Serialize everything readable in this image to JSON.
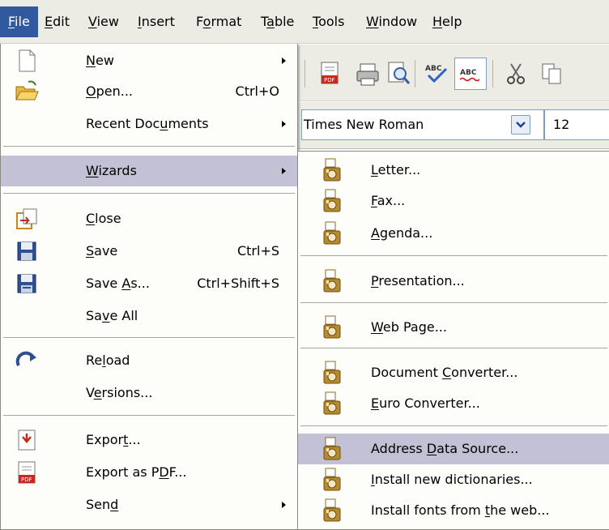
{
  "menubar": {
    "items": [
      {
        "label": "File",
        "mnemonic": "F",
        "rest": "ile"
      },
      {
        "label": "Edit",
        "mnemonic": "E",
        "rest": "dit"
      },
      {
        "label": "View",
        "mnemonic": "V",
        "rest": "iew"
      },
      {
        "label": "Insert",
        "mnemonic": "I",
        "rest": "nsert"
      },
      {
        "label": "Format",
        "pre": "F",
        "mnemonic": "o",
        "rest": "rmat"
      },
      {
        "label": "Table",
        "pre": "T",
        "mnemonic": "a",
        "rest": "ble"
      },
      {
        "label": "Tools",
        "mnemonic": "T",
        "rest": "ools"
      },
      {
        "label": "Window",
        "mnemonic": "W",
        "rest": "indow"
      },
      {
        "label": "Help",
        "mnemonic": "H",
        "rest": "elp"
      }
    ]
  },
  "toolbar": {
    "font_name": "Times New Roman",
    "font_size": "12",
    "icons": [
      "export-pdf-icon",
      "print-icon",
      "page-preview-icon",
      "spellcheck-icon",
      "autospellcheck-icon",
      "cut-icon",
      "copy-icon"
    ]
  },
  "file_menu": {
    "new": {
      "pre": "",
      "mn": "N",
      "post": "ew"
    },
    "open": {
      "pre": "",
      "mn": "O",
      "post": "pen...",
      "accel": "Ctrl+O"
    },
    "recent": {
      "pre": "Recent Doc",
      "mn": "u",
      "post": "ments"
    },
    "wizards": {
      "pre": "",
      "mn": "W",
      "post": "izards"
    },
    "close": {
      "pre": "",
      "mn": "C",
      "post": "lose"
    },
    "save": {
      "pre": "",
      "mn": "S",
      "post": "ave",
      "accel": "Ctrl+S"
    },
    "save_as": {
      "pre": "Save ",
      "mn": "A",
      "post": "s...",
      "accel": "Ctrl+Shift+S"
    },
    "save_all": {
      "pre": "Sa",
      "mn": "v",
      "post": "e All"
    },
    "reload": {
      "pre": "Re",
      "mn": "l",
      "post": "oad"
    },
    "versions": {
      "pre": "V",
      "mn": "e",
      "post": "rsions..."
    },
    "export": {
      "pre": "Expor",
      "mn": "t",
      "post": "..."
    },
    "export_pdf": {
      "pre": "Export as P",
      "mn": "D",
      "post": "F..."
    },
    "send": {
      "pre": "Sen",
      "mn": "d",
      "post": ""
    }
  },
  "wizards_menu": {
    "letter": {
      "pre": "",
      "mn": "L",
      "post": "etter..."
    },
    "fax": {
      "pre": "",
      "mn": "F",
      "post": "ax..."
    },
    "agenda": {
      "pre": "",
      "mn": "A",
      "post": "genda..."
    },
    "presentation": {
      "pre": "",
      "mn": "P",
      "post": "resentation..."
    },
    "web_page": {
      "pre": "",
      "mn": "W",
      "post": "eb Page..."
    },
    "doc_converter": {
      "pre": "Document ",
      "mn": "C",
      "post": "onverter..."
    },
    "euro_converter": {
      "pre": "",
      "mn": "E",
      "post": "uro Converter..."
    },
    "address_source": {
      "pre": "Address ",
      "mn": "D",
      "post": "ata Source..."
    },
    "dictionaries": {
      "pre": "",
      "mn": "I",
      "post": "nstall new dictionaries..."
    },
    "fonts": {
      "pre": "Install fonts from ",
      "mn": "t",
      "post": "he web..."
    }
  },
  "colors": {
    "menubar_bg": "#ecebe4",
    "menu_bg": "#fdfdf9",
    "highlight": "#c2c1d5",
    "active_menu": "#31599e"
  }
}
